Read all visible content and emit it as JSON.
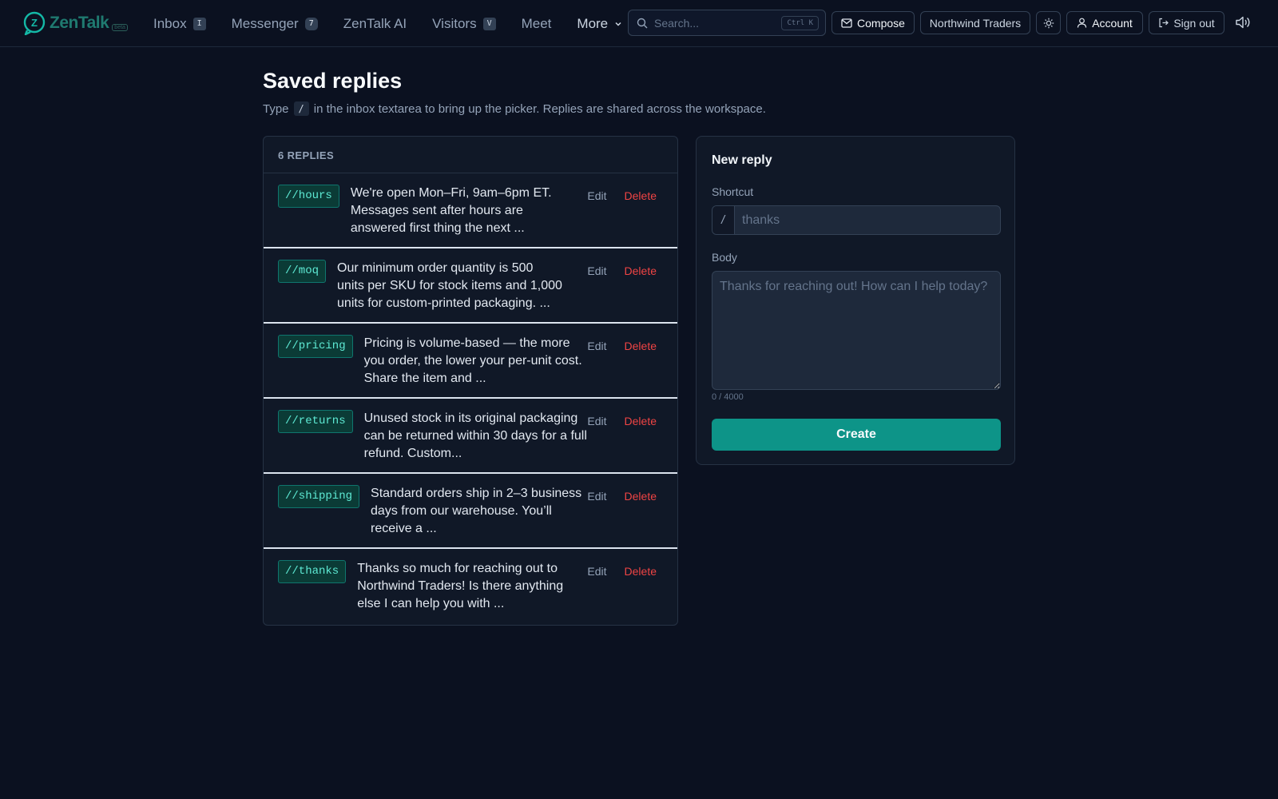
{
  "app": {
    "name": "ZenTalk",
    "tag": "beta"
  },
  "nav": {
    "items": [
      {
        "label": "Inbox",
        "badge": "I"
      },
      {
        "label": "Messenger",
        "badge": "7"
      },
      {
        "label": "ZenTalk AI",
        "badge": ""
      },
      {
        "label": "Visitors",
        "badge": "V"
      },
      {
        "label": "Meet",
        "badge": ""
      }
    ],
    "more_label": "More"
  },
  "search": {
    "placeholder": "Search...",
    "shortcut": "Ctrl K"
  },
  "toolbar": {
    "compose_label": "Compose",
    "workspace_label": "Northwind Traders",
    "account_label": "Account",
    "signout_label": "Sign out"
  },
  "page": {
    "title": "Saved replies",
    "subtitle_before": "Type",
    "subtitle_code": "/",
    "subtitle_after": "in the inbox textarea to bring up the picker. Replies are shared across the workspace."
  },
  "list": {
    "header": "6 REPLIES",
    "edit_label": "Edit",
    "delete_label": "Delete",
    "replies": [
      {
        "shortcut": "//hours",
        "preview": "We're open Mon–Fri, 9am–6pm ET. Messages sent after hours are answered first thing the next ..."
      },
      {
        "shortcut": "//moq",
        "preview": "Our minimum order quantity is 500 units per SKU for stock items and 1,000 units for custom-printed packaging. ..."
      },
      {
        "shortcut": "//pricing",
        "preview": "Pricing is volume-based — the more you order, the lower your per-unit cost. Share the item and ..."
      },
      {
        "shortcut": "//returns",
        "preview": "Unused stock in its original packaging can be returned within 30 days for a full refund. Custom..."
      },
      {
        "shortcut": "//shipping",
        "preview": "Standard orders ship in 2–3 business days from our warehouse. You’ll receive a ..."
      },
      {
        "shortcut": "//thanks",
        "preview": "Thanks so much for reaching out to Northwind Traders! Is there anything else I can help you with ..."
      }
    ]
  },
  "form": {
    "title": "New reply",
    "shortcut_label": "Shortcut",
    "shortcut_prefix": "/",
    "shortcut_placeholder": "thanks",
    "shortcut_value": "",
    "body_label": "Body",
    "body_placeholder": "Thanks for reaching out! How can I help today?",
    "body_value": "",
    "counter": "0 / 4000",
    "submit_label": "Create"
  },
  "colors": {
    "background": "#0b1120",
    "accent": "#0d9488",
    "danger": "#ef4444",
    "tag_text": "#5eead4"
  },
  "icons": [
    "zentalk-logo",
    "search-icon",
    "mail-icon",
    "sun-icon",
    "user-icon",
    "logout-icon",
    "speaker-icon",
    "chevron-down-icon"
  ]
}
